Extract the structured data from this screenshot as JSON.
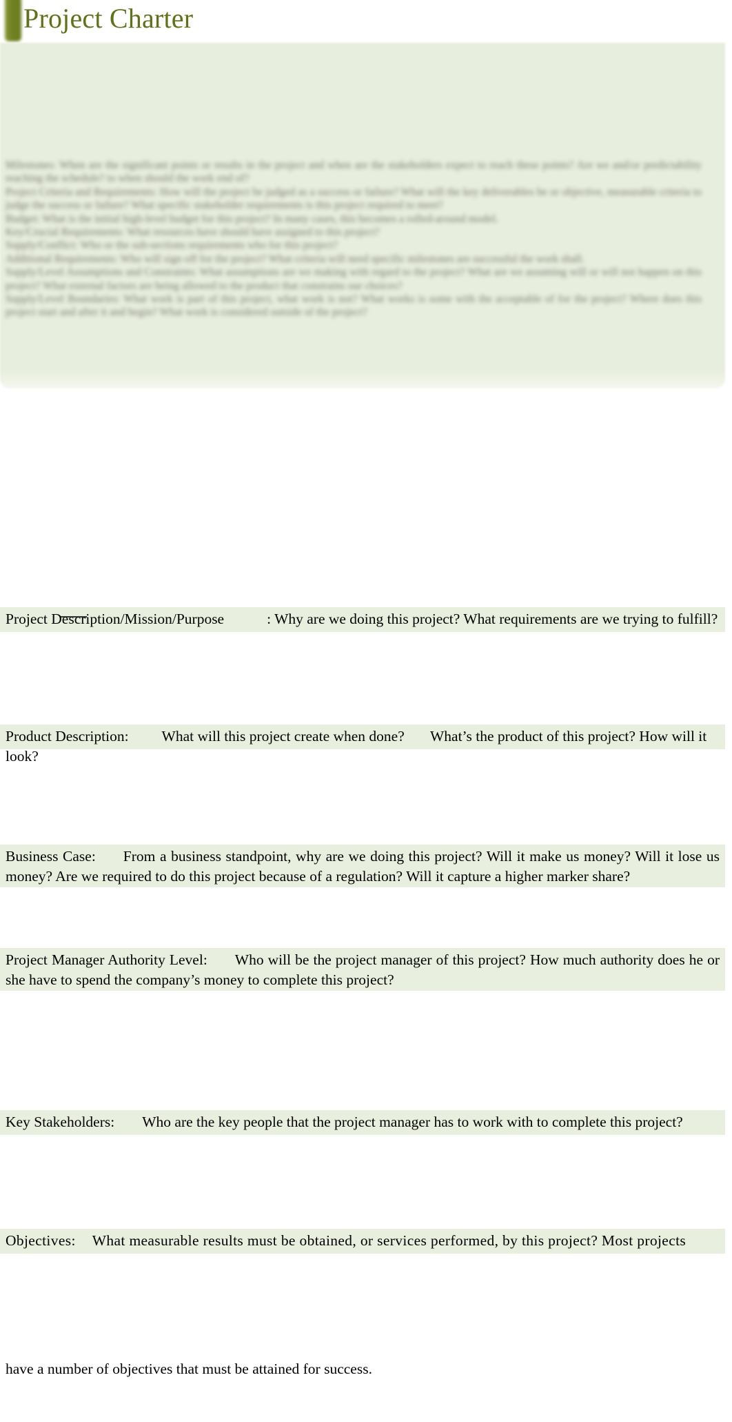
{
  "document": {
    "title": "Project Charter",
    "title_color": "#5d7219",
    "panel_color": "#e8eedd",
    "highlight_color": "#e9efdf",
    "accent_bar_color": "#6b7d1f"
  },
  "preview_block": {
    "note": "blurred out-of-focus copy of the charter body",
    "lines": [
      "Milestones:      When are the significant points or results in the project and when are the stakeholders expect to reach these points? Are we  and/or predictability  reaching the  schedule?  to  when should the work end of?",
      "Project Criteria and Requirements:          How will the project be judged as a success or failure? What will the key deliverables be or objective, measurable criteria to judge the success or failure? What specific stakeholder requirements is this project required to meet?",
      "Budget:       What is the initial high-level budget for this project? In many cases, this becomes a rolled-around model.",
      "Key/Crucial Requirements:         What resources have should have assigned to this project?",
      "Supply/Conflict:      Who or the sub-sections  requirements who for this project?",
      "Additional Requirements:         Who will sign off for the project? What criteria will need specific milestones are successful the work shall.",
      "Supply/Level Assumptions and Constraints:             What assumptions are we making with regard to the project? What are we assuming will or will not happen on this project? What external factors are being allowed to the product that constrains our choices?",
      "Supply/Level Boundaries:         What work is part of this project, what work is not? What works is some with the acceptable of for the project? Where does this project start and after it and begin? What work is considered outside of the project?"
    ]
  },
  "sections": [
    {
      "id": "project-description",
      "label": "Project Description/Mission/Purpose",
      "body": ": Why are we doing this project? What requirements are we trying to fulfill?"
    },
    {
      "id": "product-description",
      "label": "Product Description:",
      "body": "What will this project create when done?       What’s the product of this project? How will it look?"
    },
    {
      "id": "business-case",
      "label": "Business Case:",
      "body": "From a business standpoint, why are we doing this project? Will it make us money? Will it lose us money? Are we required to do this project because of a regulation? Will it capture a higher marker share?"
    },
    {
      "id": "pm-authority-level",
      "label": "Project Manager Authority Level:",
      "body": "Who will be the project manager of this project? How much authority does he or she have to spend the company’s money to complete this project?"
    },
    {
      "id": "key-stakeholders",
      "label": "Key Stakeholders:",
      "body": "Who are the key people that the project manager has to work with to complete this project?"
    },
    {
      "id": "objectives",
      "label": "Objectives:",
      "body": "What measurable results must be obtained, or services performed, by this project? Most projects"
    }
  ],
  "tail": {
    "text": "have a number of objectives that must be attained for success."
  }
}
